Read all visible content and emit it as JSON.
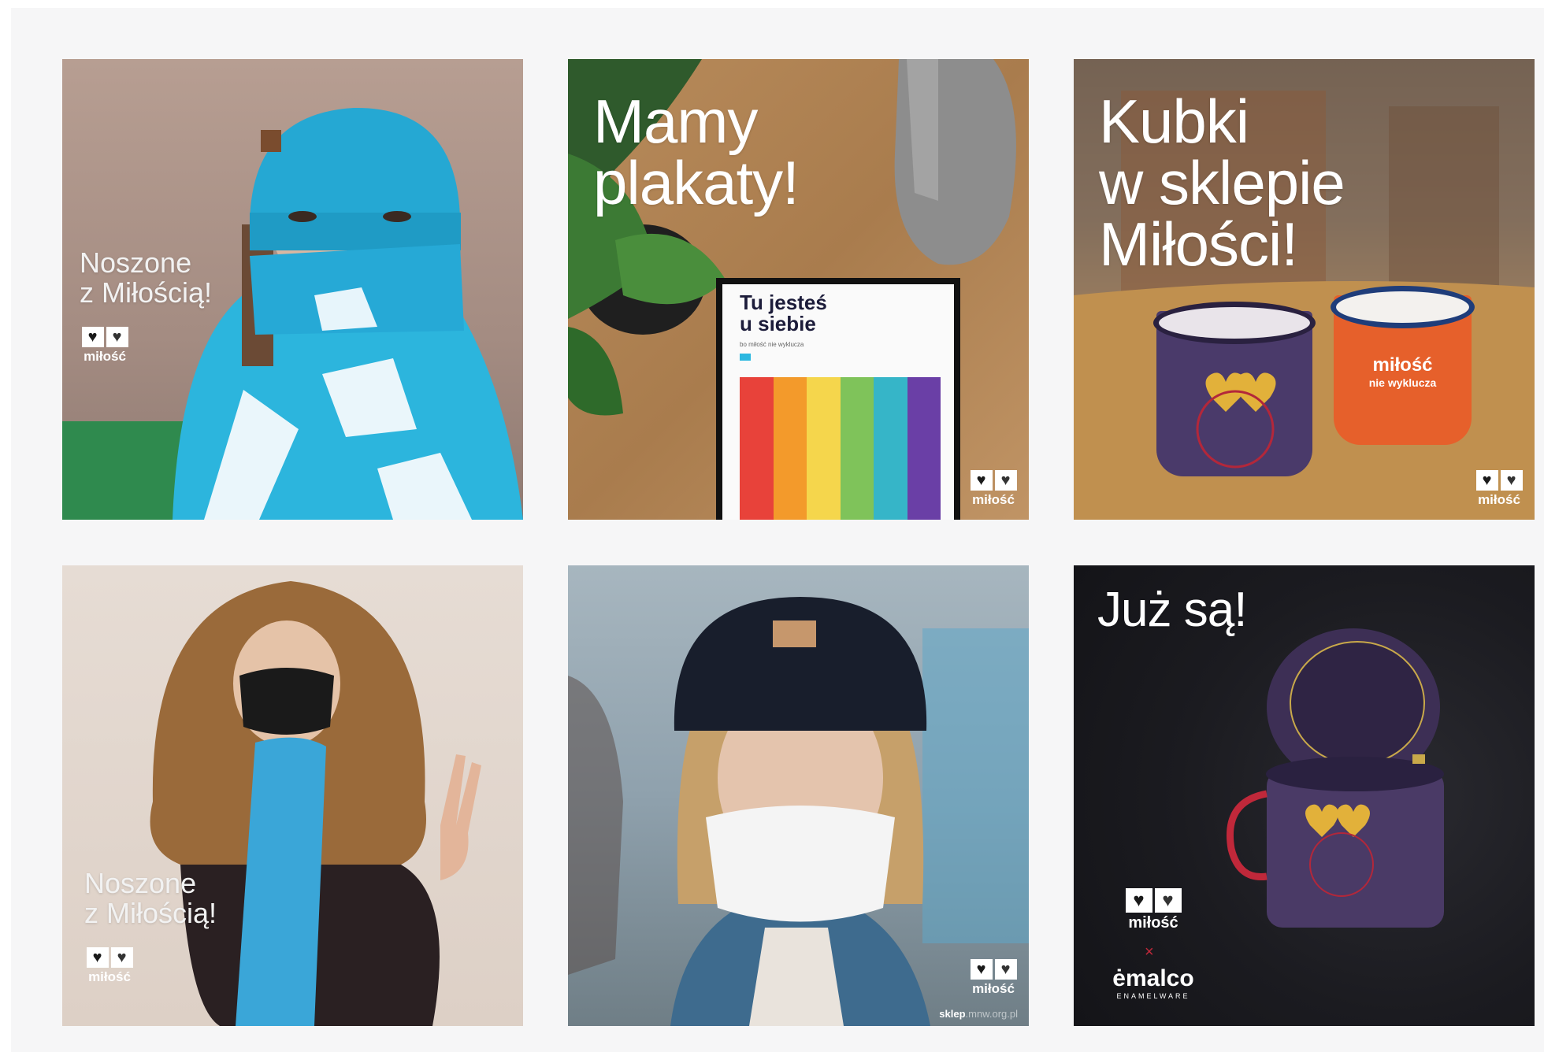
{
  "tiles": [
    {
      "overlay_lines": [
        "Noszone",
        "z Miłością!"
      ],
      "logo_text": "miłość"
    },
    {
      "overlay_lines": [
        "Mamy",
        "plakaty!"
      ],
      "logo_text": "miłość",
      "poster": {
        "title_line1": "Tu jesteś",
        "title_line2": "u siebie",
        "subtitle": "bo miłość nie wyklucza",
        "stripe_colors": [
          "#e8423a",
          "#f39a2b",
          "#f5d64c",
          "#7fc35a",
          "#36b5c8",
          "#6a3fa6"
        ]
      }
    },
    {
      "overlay_lines": [
        "Kubki",
        "w sklepie",
        "Miłości!"
      ],
      "logo_text": "miłość",
      "mug_label_1": "miłość",
      "mug_label_2": "nie wyklucza"
    },
    {
      "overlay_lines": [
        "Noszone",
        "z Miłością!"
      ],
      "logo_text": "miłość"
    },
    {
      "overlay_lines": [],
      "logo_text": "miłość",
      "shop_url_bold": "sklep",
      "shop_url_rest": ".mnw.org.pl"
    },
    {
      "overlay_lines": [
        "Już są!"
      ],
      "logo_text": "miłość",
      "separator": "×",
      "partner_name": "ėmalco",
      "partner_sub": "ENAMELWARE"
    }
  ],
  "colors": {
    "background": "#f6f6f7",
    "brand": "#2bb7e0"
  },
  "icons": [
    "heart-icon",
    "heart-outline-icon"
  ]
}
